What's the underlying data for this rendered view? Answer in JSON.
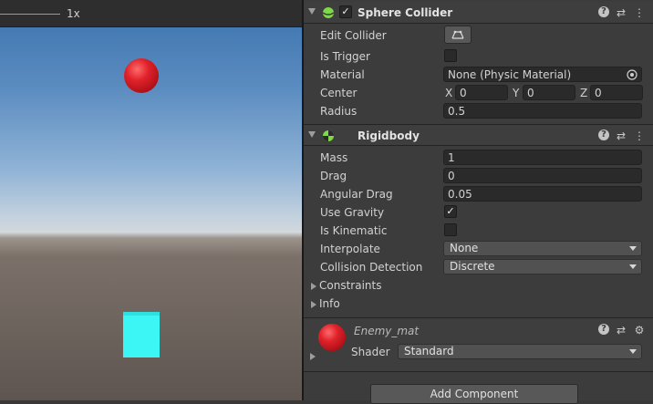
{
  "game_view": {
    "zoom_label": "1x"
  },
  "sphere_collider": {
    "title": "Sphere Collider",
    "enabled": true,
    "edit_collider_label": "Edit Collider",
    "is_trigger_label": "Is Trigger",
    "is_trigger": false,
    "material_label": "Material",
    "material_value": "None (Physic Material)",
    "center_label": "Center",
    "center": {
      "x_label": "X",
      "x": "0",
      "y_label": "Y",
      "y": "0",
      "z_label": "Z",
      "z": "0"
    },
    "radius_label": "Radius",
    "radius": "0.5"
  },
  "rigidbody": {
    "title": "Rigidbody",
    "mass_label": "Mass",
    "mass": "1",
    "drag_label": "Drag",
    "drag": "0",
    "angular_drag_label": "Angular Drag",
    "angular_drag": "0.05",
    "use_gravity_label": "Use Gravity",
    "use_gravity": true,
    "is_kinematic_label": "Is Kinematic",
    "is_kinematic": false,
    "interpolate_label": "Interpolate",
    "interpolate": "None",
    "collision_detection_label": "Collision Detection",
    "collision_detection": "Discrete",
    "constraints_label": "Constraints",
    "info_label": "Info"
  },
  "material": {
    "name": "Enemy_mat",
    "shader_label": "Shader",
    "shader": "Standard"
  },
  "add_component_label": "Add Component",
  "icons": {
    "help": "?",
    "settings": "⇄",
    "menu": "⋮",
    "check": "✓"
  },
  "colors": {
    "collider_icon": "#7fd84a",
    "cube": "#3cf5f5",
    "sphere": "#e0222b"
  }
}
